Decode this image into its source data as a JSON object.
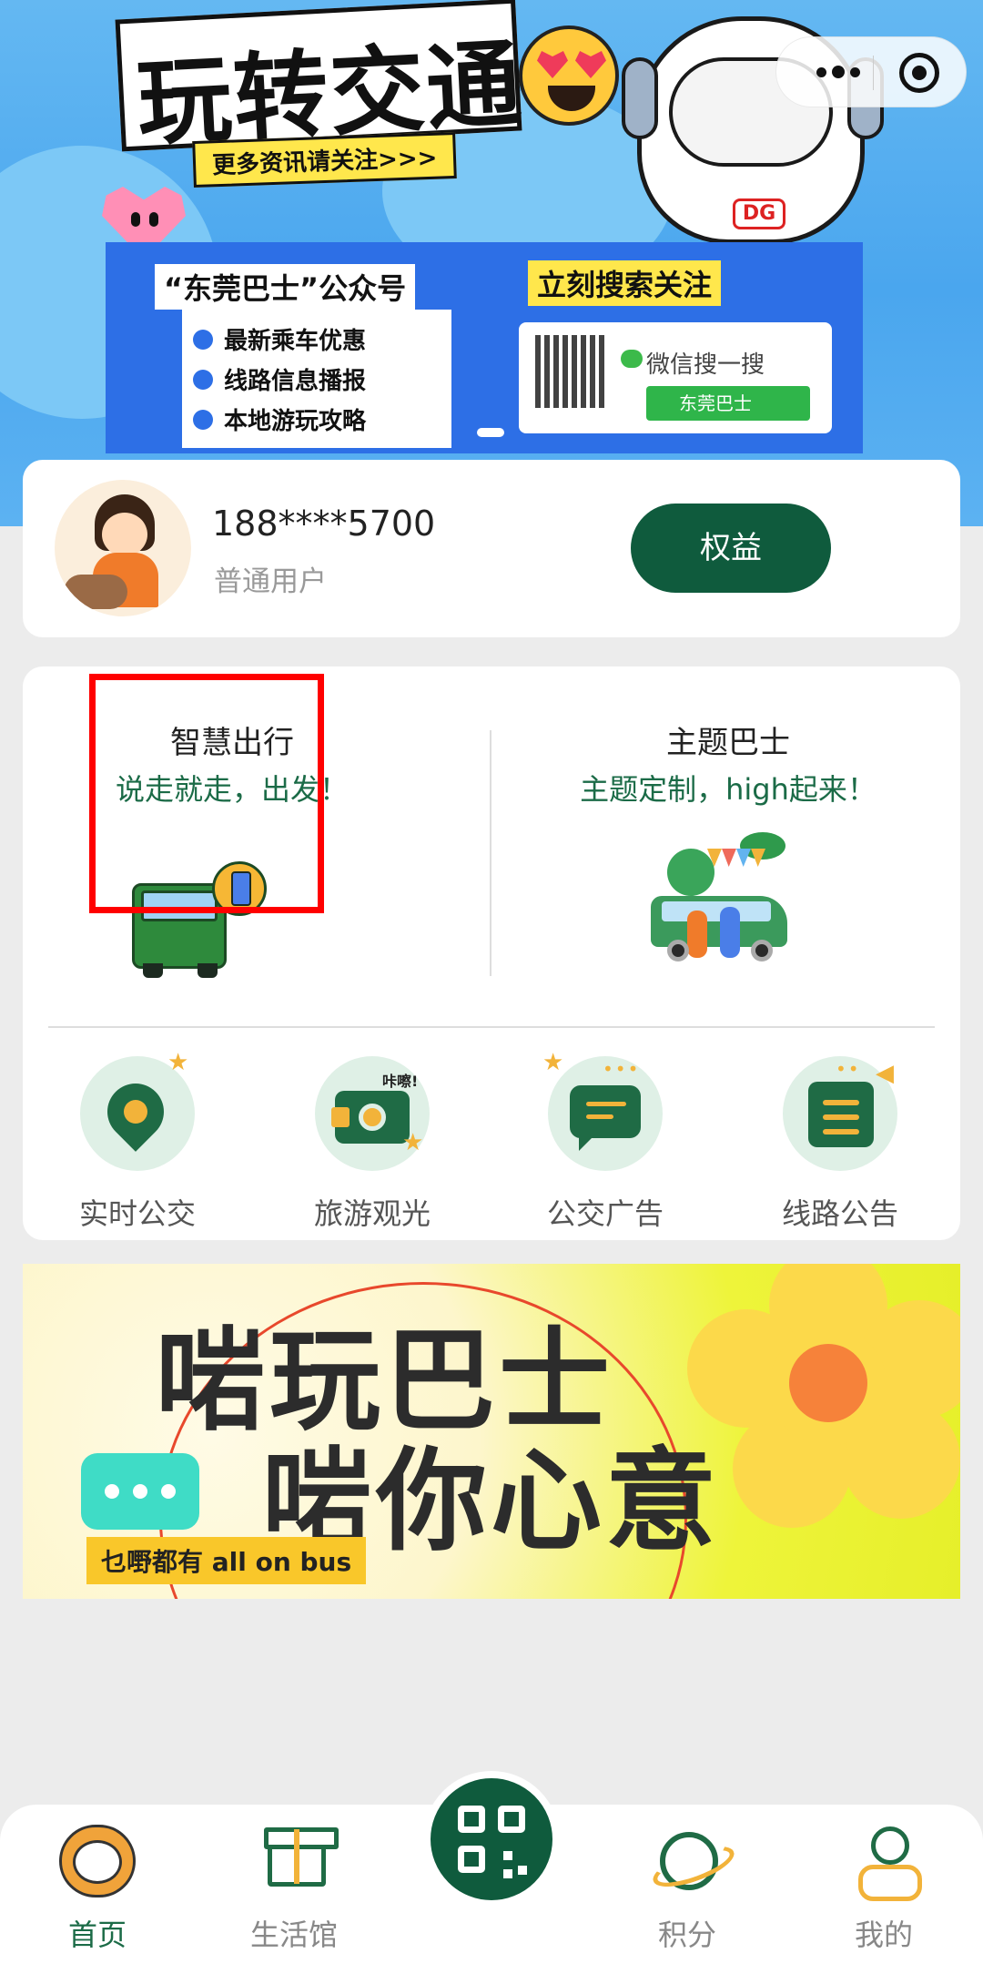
{
  "banner": {
    "title": "玩转交通",
    "subtitle": "更多资讯请关注>>>",
    "account_label": "“东莞巴士”公众号",
    "search_label": "立刻搜索关注",
    "features": [
      "最新乘车优惠",
      "线路信息播报",
      "本地游玩攻略"
    ],
    "wechat_search": "微信搜一搜",
    "search_query": "东莞巴士",
    "badge": "DG"
  },
  "user": {
    "phone": "188****5700",
    "type": "普通用户",
    "benefits_label": "权益"
  },
  "features": [
    {
      "title": "智慧出行",
      "subtitle": "说走就走，出发！"
    },
    {
      "title": "主题巴士",
      "subtitle": "主题定制，high起来！"
    }
  ],
  "quick": [
    {
      "label": "实时公交",
      "icon": "location-pin-icon"
    },
    {
      "label": "旅游观光",
      "icon": "camera-icon",
      "tag": "咔嚓!"
    },
    {
      "label": "公交广告",
      "icon": "chat-bubble-icon"
    },
    {
      "label": "线路公告",
      "icon": "announcement-icon"
    }
  ],
  "promo": {
    "line1": "啱玩巴士",
    "line2": "啱你心意",
    "tagline": "乜嘢都有 all on bus"
  },
  "nav": [
    {
      "label": "首页",
      "active": true
    },
    {
      "label": "生活馆",
      "active": false
    },
    {
      "label": "积分",
      "active": false
    },
    {
      "label": "我的",
      "active": false
    }
  ],
  "colors": {
    "primary": "#0f5b3d",
    "accent": "#f2b33a",
    "highlight_border": "#ff0000"
  }
}
